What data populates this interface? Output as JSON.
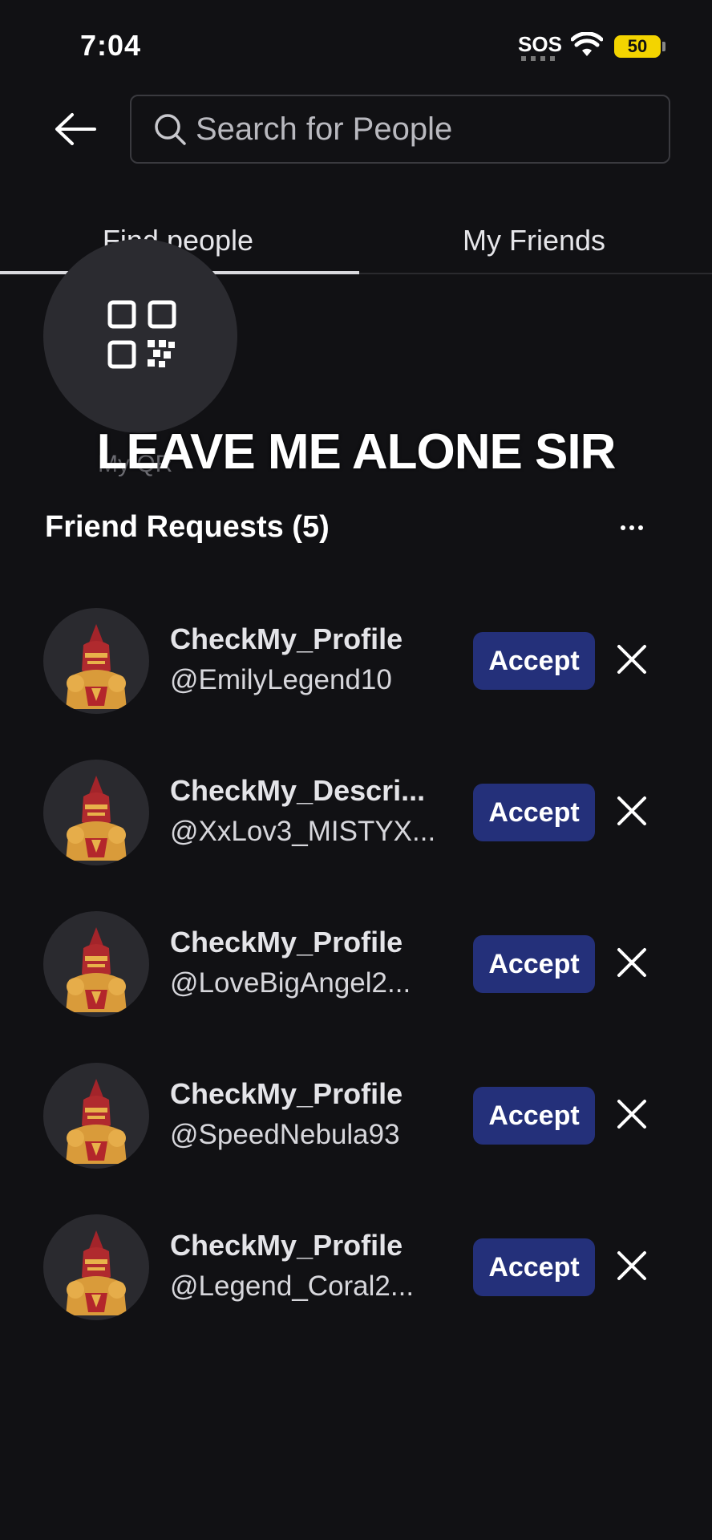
{
  "status_bar": {
    "time": "7:04",
    "sos": "SOS",
    "battery": "50",
    "battery_color": "#f3d400"
  },
  "header": {
    "back_icon": "arrow-left-icon",
    "search_placeholder": "Search for People"
  },
  "tabs": [
    {
      "label": "Find people",
      "active": true
    },
    {
      "label": "My Friends",
      "active": false
    }
  ],
  "qr": {
    "label": "My QR"
  },
  "overlay_caption": "LEAVE ME ALONE SIR",
  "friend_requests": {
    "title": "Friend Requests (5)",
    "accept_label": "Accept",
    "accent_color": "#24307a",
    "items": [
      {
        "display_name": "CheckMy_Profile",
        "username": "@EmilyLegend10"
      },
      {
        "display_name": "CheckMy_Descri...",
        "username": "@XxLov3_MISTYX..."
      },
      {
        "display_name": "CheckMy_Profile",
        "username": "@LoveBigAngel2..."
      },
      {
        "display_name": "CheckMy_Profile",
        "username": "@SpeedNebula93"
      },
      {
        "display_name": "CheckMy_Profile",
        "username": "@Legend_Coral2..."
      }
    ]
  }
}
